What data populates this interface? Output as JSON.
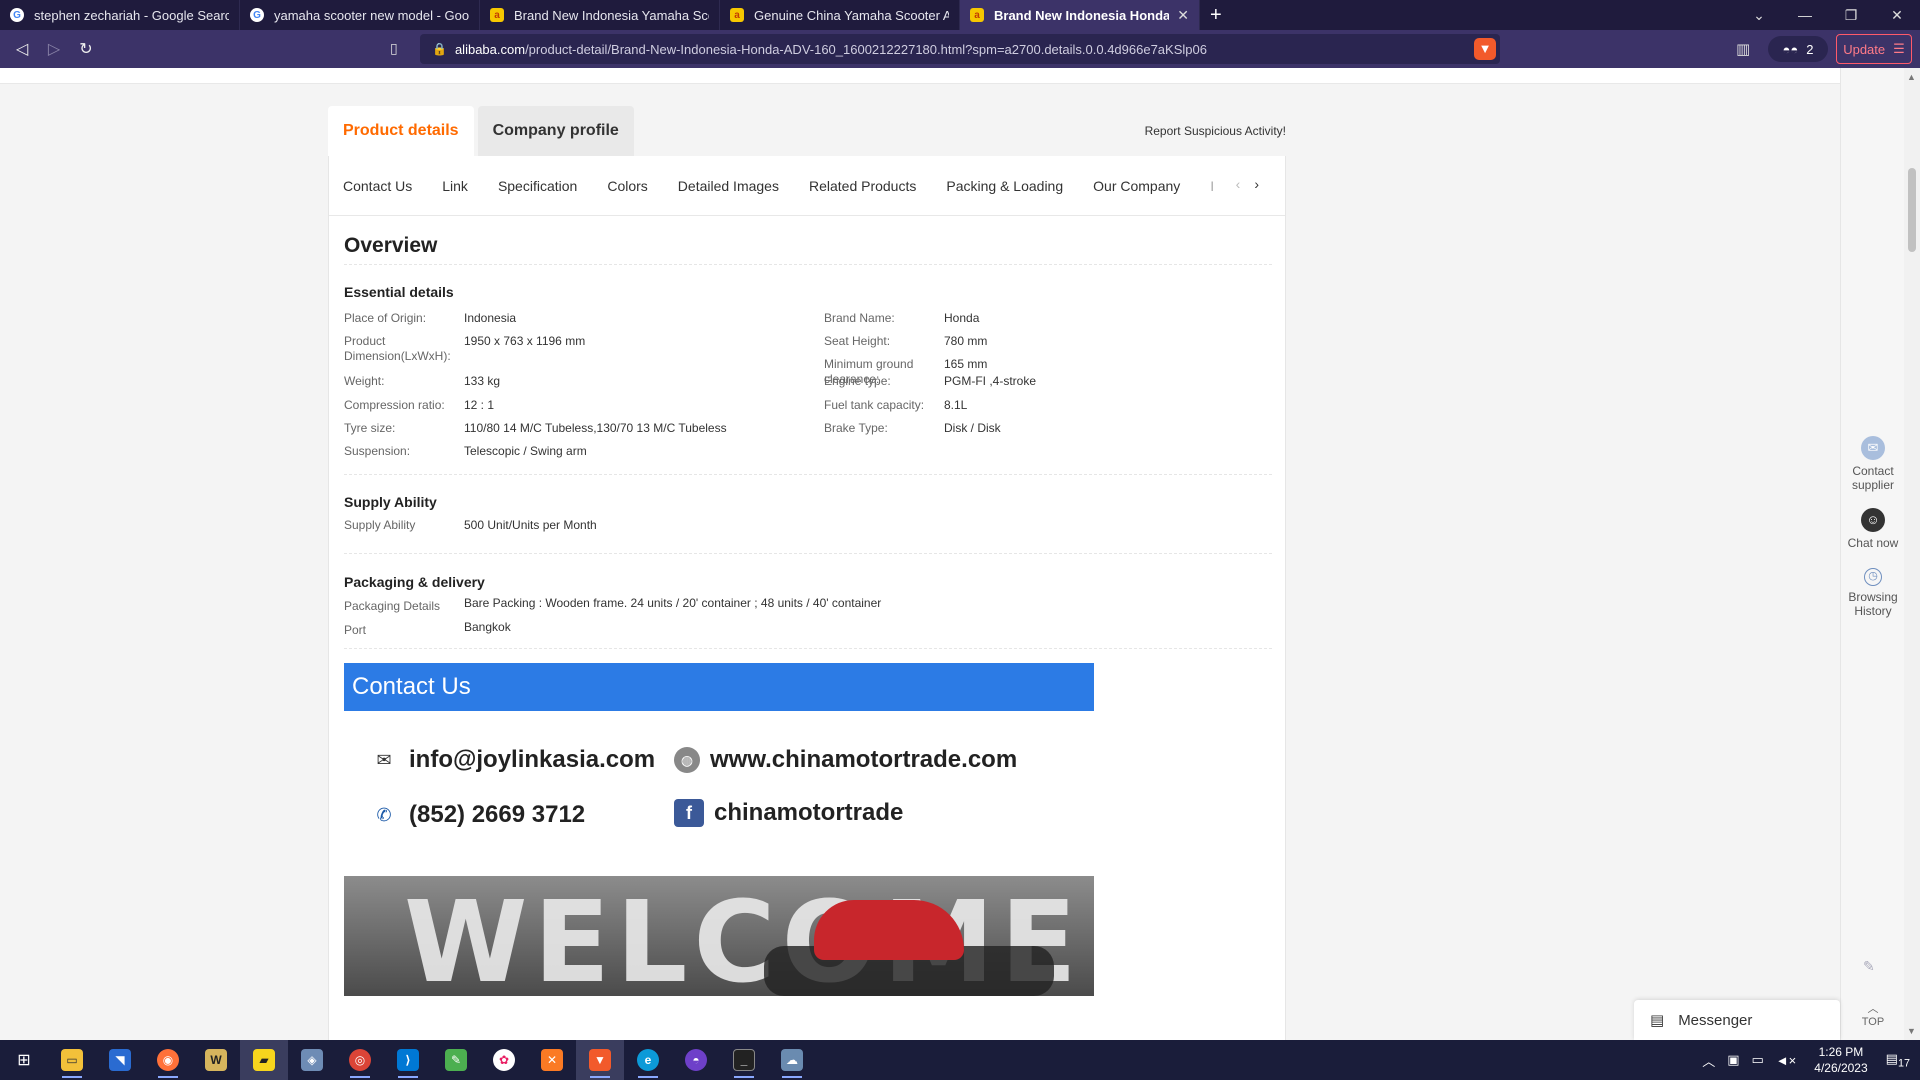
{
  "browser": {
    "tabs": [
      {
        "title": "stephen zechariah - Google Search",
        "icon": "google-icon",
        "active": false
      },
      {
        "title": "yamaha scooter new model - Google S",
        "icon": "google-icon",
        "active": false
      },
      {
        "title": "Brand New Indonesia Yamaha Scooter",
        "icon": "alibaba-icon",
        "active": false
      },
      {
        "title": "Genuine China Yamaha Scooter Aeros",
        "icon": "alibaba-icon",
        "active": false
      },
      {
        "title": "Brand New Indonesia Honda Adv",
        "icon": "alibaba-icon",
        "active": true
      }
    ],
    "url_host": "alibaba.com",
    "url_path": "/product-detail/Brand-New-Indonesia-Honda-ADV-160_1600212227180.html?spm=a2700.details.0.0.4d966e7aKSlp06",
    "wallet_count": "2",
    "update_label": "Update"
  },
  "page": {
    "tabs": [
      "Product details",
      "Company profile"
    ],
    "report": "Report Suspicious Activity!",
    "subnav": [
      "Contact Us",
      "Link",
      "Specification",
      "Colors",
      "Detailed Images",
      "Related Products",
      "Packing & Loading",
      "Our Company",
      "I"
    ],
    "overview_title": "Overview",
    "essential_title": "Essential details",
    "essential_left": [
      {
        "k": "Place of Origin:",
        "v": "Indonesia"
      },
      {
        "k": "Product Dimension(LxWxH):",
        "v": "1950 x 763 x 1196 mm"
      },
      {
        "k": "Weight:",
        "v": "133 kg"
      },
      {
        "k": "Compression ratio:",
        "v": "12 : 1"
      },
      {
        "k": "Tyre size:",
        "v": "110/80 14 M/C Tubeless,130/70 13 M/C Tubeless"
      },
      {
        "k": "Suspension:",
        "v": "Telescopic / Swing arm"
      }
    ],
    "essential_right": [
      {
        "k": "Brand Name:",
        "v": "Honda"
      },
      {
        "k": "Seat Height:",
        "v": "780 mm"
      },
      {
        "k": "Minimum ground clearance:",
        "v": "165 mm"
      },
      {
        "k": "Engine type:",
        "v": "PGM-FI ,4-stroke"
      },
      {
        "k": "Fuel tank capacity:",
        "v": "8.1L"
      },
      {
        "k": "Brake Type:",
        "v": "Disk / Disk"
      }
    ],
    "supply_title": "Supply Ability",
    "supply": [
      {
        "k": "Supply Ability",
        "v": "500 Unit/Units per Month"
      }
    ],
    "packaging_title": "Packaging & delivery",
    "packaging": [
      {
        "k": "Packaging Details",
        "v": "Bare Packing : Wooden frame. 24 units / 20' container ; 48 units / 40' container"
      },
      {
        "k": "Port",
        "v": "Bangkok"
      }
    ],
    "contact_banner": "Contact Us",
    "contact": {
      "email": "info@joylinkasia.com",
      "website": "www.chinamotortrade.com",
      "phone": "(852) 2669 3712",
      "facebook": "chinamotortrade"
    },
    "welcome_text": "WELCOME"
  },
  "rail": {
    "contact_supplier": "Contact supplier",
    "chat_now": "Chat now",
    "browsing_history": "Browsing History",
    "top": "TOP"
  },
  "messenger_label": "Messenger",
  "clock": {
    "time": "1:26 PM",
    "date": "4/26/2023"
  },
  "notification_count": "17",
  "colors": {
    "accent": "#ff6a00",
    "banner": "#2c7be5",
    "tabbar": "#1f1b3d"
  }
}
